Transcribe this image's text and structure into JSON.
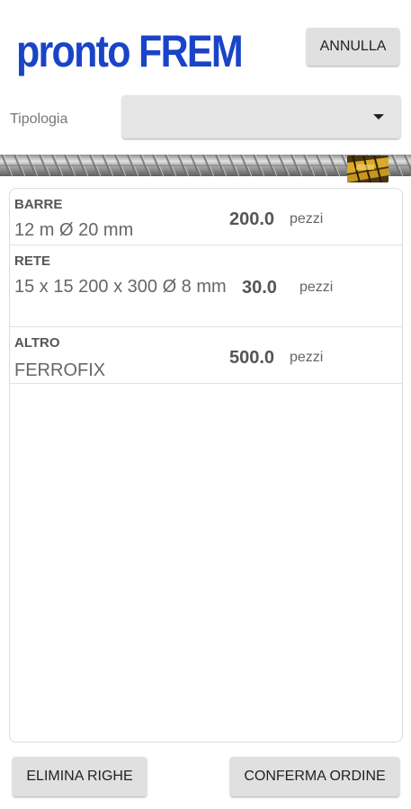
{
  "header": {
    "logo": "pronto FREM",
    "cancel_label": "ANNULLA"
  },
  "filter": {
    "label": "Tipologia",
    "selected": ""
  },
  "items": [
    {
      "category": "BARRE",
      "description": "12 m Ø 20 mm",
      "quantity": "200.0",
      "unit": "pezzi"
    },
    {
      "category": "RETE",
      "description": "15 x 15 200 x 300 Ø 8 mm",
      "quantity": "30.0",
      "unit": "pezzi"
    },
    {
      "category": "ALTRO",
      "description": "FERROFIX",
      "quantity": "500.0",
      "unit": "pezzi",
      "thumbnail": "ferrofix-product-image"
    }
  ],
  "footer": {
    "delete_label": "ELIMINA RIGHE",
    "confirm_label": "CONFERMA ORDINE"
  },
  "colors": {
    "brand": "#1a44c8",
    "button": "#e0e0e0"
  }
}
